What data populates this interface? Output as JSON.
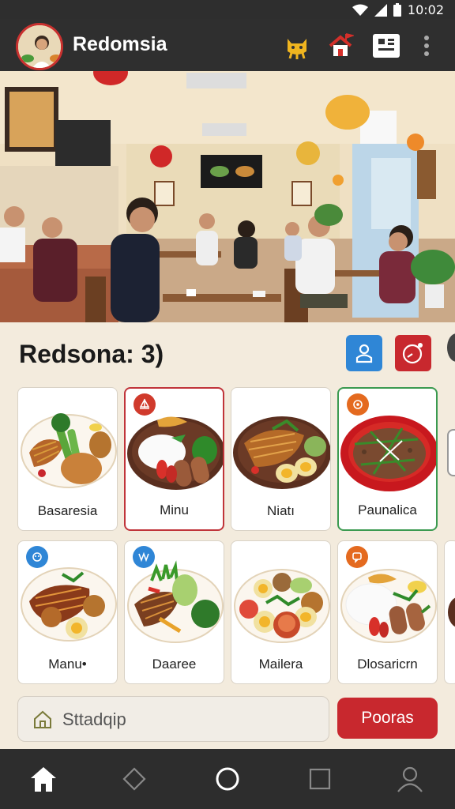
{
  "status_bar": {
    "time": "10:02",
    "icons": [
      "wifi-icon",
      "signal-icon",
      "battery-icon"
    ]
  },
  "app_bar": {
    "title": "Redomsia",
    "actions": [
      "cat-mascot-icon",
      "home-flag-icon",
      "calendar-grid-icon",
      "more-vert-icon"
    ]
  },
  "section": {
    "title": "Redsona: 3)"
  },
  "cards": [
    {
      "label": "Basaresia"
    },
    {
      "label": "Minu"
    },
    {
      "label": "Niatı"
    },
    {
      "label": "Paunalica"
    },
    {
      "label": "Manu•"
    },
    {
      "label": "Daaree"
    },
    {
      "label": "Mailera"
    },
    {
      "label": "Dlosaricrn"
    }
  ],
  "search": {
    "placeholder": "Sttadqip"
  },
  "action_button": {
    "label": "Pooras"
  },
  "bottom_nav": [
    "home-icon",
    "diamond-icon",
    "circle-icon",
    "square-icon",
    "profile-icon"
  ],
  "colors": {
    "accent_red": "#c8282e",
    "accent_blue": "#2f86d6",
    "bar_dark": "#2f2f2f"
  }
}
